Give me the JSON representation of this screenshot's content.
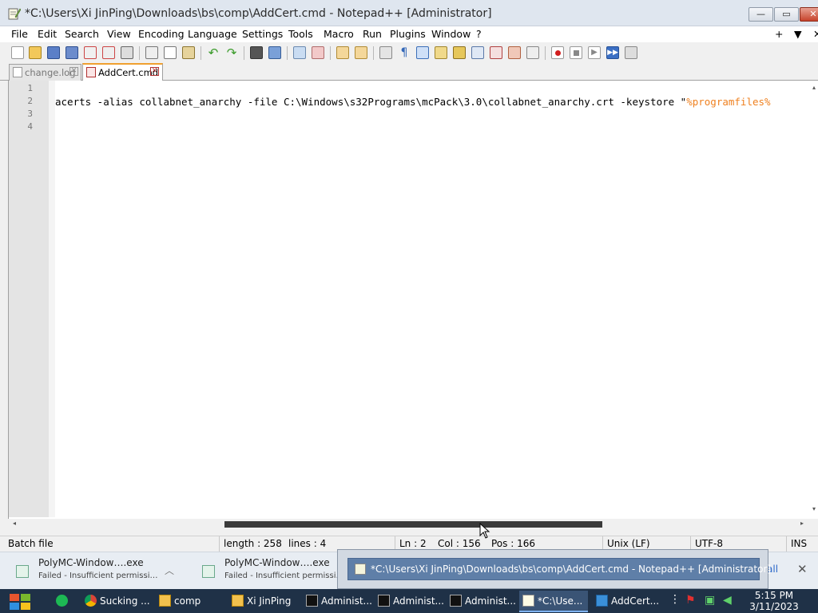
{
  "window": {
    "title": "*C:\\Users\\Xi JinPing\\Downloads\\bs\\comp\\AddCert.cmd - Notepad++ [Administrator]",
    "controls": {
      "minimize": "—",
      "maximize": "▭",
      "close": "✕"
    }
  },
  "menu": {
    "items": [
      "File",
      "Edit",
      "Search",
      "View",
      "Encoding",
      "Language",
      "Settings",
      "Tools",
      "Macro",
      "Run",
      "Plugins",
      "Window",
      "?"
    ],
    "right": [
      "+",
      "▼",
      "✕"
    ]
  },
  "tabs": [
    {
      "label": "change.log",
      "active": false
    },
    {
      "label": "AddCert.cmd",
      "active": true
    }
  ],
  "editor": {
    "line_numbers": [
      "1",
      "2",
      "3",
      "4"
    ],
    "line2_plain": "acerts -alias collabnet_anarchy -file C:\\Windows\\s32Programs\\mcPack\\3.0\\collabnet_anarchy.crt -keystore \"",
    "line2_string": "%programfiles%"
  },
  "statusbar": {
    "file_type": "Batch file",
    "length": "length : 258",
    "lines": "lines : 4",
    "ln": "Ln : 2",
    "col": "Col : 156",
    "pos": "Pos : 166",
    "eol": "Unix (LF)",
    "encoding": "UTF-8",
    "mode": "INS"
  },
  "notifications": [
    {
      "name": "PolyMC-Window….exe",
      "sub": "Failed - Insufficient permissi…"
    },
    {
      "name": "PolyMC-Window….exe",
      "sub": "Failed - Insufficient permissi…"
    }
  ],
  "notif_link": "all",
  "thumbnail_tip": "*C:\\Users\\Xi JinPing\\Downloads\\bs\\comp\\AddCert.cmd - Notepad++ [Administrator]",
  "taskbar": {
    "buttons": [
      {
        "label": "Sucking ...",
        "icon": "chrome-icon"
      },
      {
        "label": "comp",
        "icon": "folder-icon"
      },
      {
        "label": "Xi JinPing",
        "icon": "user-folder-icon"
      },
      {
        "label": "Administ...",
        "icon": "cmd-icon"
      },
      {
        "label": "Administ...",
        "icon": "cmd-icon"
      },
      {
        "label": "Administ...",
        "icon": "cmd-icon"
      },
      {
        "label": "*C:\\Use...",
        "icon": "notepadpp-icon"
      },
      {
        "label": "AddCert...",
        "icon": "app-icon"
      }
    ],
    "clock_time": "5:15 PM",
    "clock_date": "3/11/2023"
  },
  "colors": {
    "string_orange": "#ef8120",
    "taskbar_bg": "#1f3147",
    "tab_accent": "#f0a030"
  }
}
